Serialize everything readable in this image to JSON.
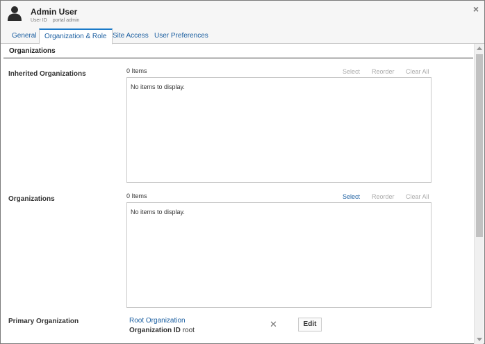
{
  "header": {
    "user_name": "Admin User",
    "user_id_label": "User ID",
    "user_id_value": "portal admin",
    "avatar_icon": "user-icon",
    "close_icon": "close-icon",
    "close_glyph": "×"
  },
  "tabs": [
    {
      "label": "General",
      "active": false
    },
    {
      "label": "Organization & Role",
      "active": true
    },
    {
      "label": "Site Access",
      "active": false
    },
    {
      "label": "User Preferences",
      "active": false
    }
  ],
  "section": {
    "title": "Organizations"
  },
  "inherited": {
    "label": "Inherited Organizations",
    "count": "0 Items",
    "actions": {
      "select": "Select",
      "reorder": "Reorder",
      "clear_all": "Clear All"
    },
    "empty": "No items to display."
  },
  "organizations": {
    "label": "Organizations",
    "count": "0 Items",
    "actions": {
      "select": "Select",
      "reorder": "Reorder",
      "clear_all": "Clear All"
    },
    "empty": "No items to display."
  },
  "primary": {
    "label": "Primary Organization",
    "org_name": "Root Organization",
    "org_id_label": "Organization ID",
    "org_id_value": "root",
    "remove_glyph": "✕",
    "edit_label": "Edit"
  },
  "colors": {
    "link": "#1a5ea0",
    "active_tab_border": "#1a7ac9",
    "disabled_action": "#aaaaaa"
  }
}
